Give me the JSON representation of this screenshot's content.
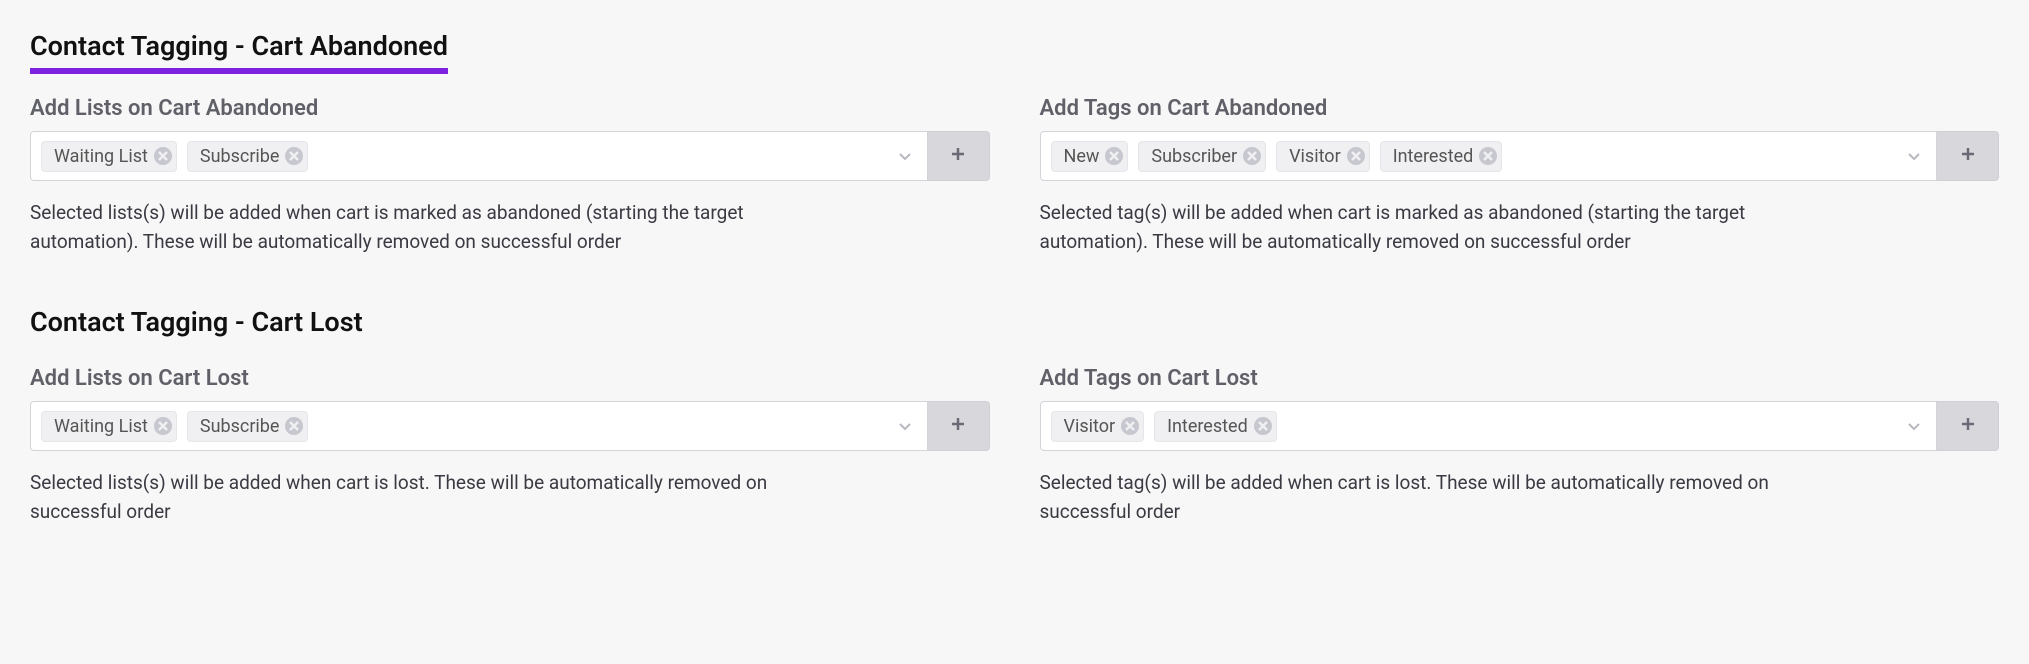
{
  "sections": [
    {
      "title": "Contact Tagging - Cart Abandoned",
      "highlighted": true,
      "left": {
        "label": "Add Lists on Cart Abandoned",
        "tags": [
          "Waiting List",
          "Subscribe"
        ],
        "help": "Selected lists(s) will be added when cart is marked as abandoned (starting the target automation). These will be automatically removed on successful order"
      },
      "right": {
        "label": "Add Tags on Cart Abandoned",
        "tags": [
          "New",
          "Subscriber",
          "Visitor",
          "Interested"
        ],
        "help": "Selected tag(s) will be added when cart is marked as abandoned (starting the target automation). These will be automatically removed on successful order"
      }
    },
    {
      "title": "Contact Tagging - Cart Lost",
      "highlighted": false,
      "left": {
        "label": "Add Lists on Cart Lost",
        "tags": [
          "Waiting List",
          "Subscribe"
        ],
        "help": "Selected lists(s) will be added when cart is lost. These will be automatically removed on successful order"
      },
      "right": {
        "label": "Add Tags on Cart Lost",
        "tags": [
          "Visitor",
          "Interested"
        ],
        "help": "Selected tag(s) will be added when cart is lost. These will be automatically removed on successful order"
      }
    }
  ]
}
